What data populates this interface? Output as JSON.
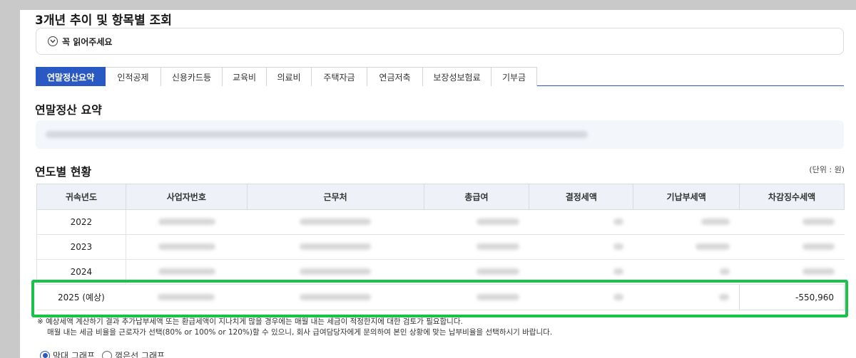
{
  "section_title": "3개년 추이 및 항목별 조회",
  "notice": {
    "label": "꼭 읽어주세요"
  },
  "tabs": [
    {
      "label": "연말정산요약",
      "active": true
    },
    {
      "label": "인적공제"
    },
    {
      "label": "신용카드등"
    },
    {
      "label": "교육비"
    },
    {
      "label": "의료비"
    },
    {
      "label": "주택자금"
    },
    {
      "label": "연금저축"
    },
    {
      "label": "보장성보험료"
    },
    {
      "label": "기부금"
    }
  ],
  "summary": {
    "title": "연말정산 요약"
  },
  "yearly": {
    "title": "연도별 현황",
    "unit": "(단위 : 원)",
    "headers": [
      "귀속년도",
      "사업자번호",
      "근무처",
      "총급여",
      "결정세액",
      "기납부세액",
      "차감징수세액"
    ],
    "rows": [
      {
        "year": "2022"
      },
      {
        "year": "2023"
      },
      {
        "year": "2024"
      },
      {
        "year": "2025 (예상)",
        "deduction": "-550,960"
      }
    ]
  },
  "footnotes": [
    "※ 예상세액 계산하기 결과 추가납부세액 또는 환급세액이 지나치게 많을 경우에는 매월 내는 세금이 적정한지에 대한 검토가 필요합니다.",
    "매월 내는 세금 비율을 근로자가 선택(80% or 100% or 120%)할 수 있으니, 회사 급여담당자에게 문의하여 본인 상황에 맞는 납부비율을 선택하시기 바랍니다."
  ],
  "graph_options": [
    {
      "label": "막대 그래프",
      "selected": true
    },
    {
      "label": "꺾은선 그래프",
      "selected": false
    }
  ],
  "colors": {
    "accent": "#2b59c3",
    "highlight": "#19c34b"
  }
}
